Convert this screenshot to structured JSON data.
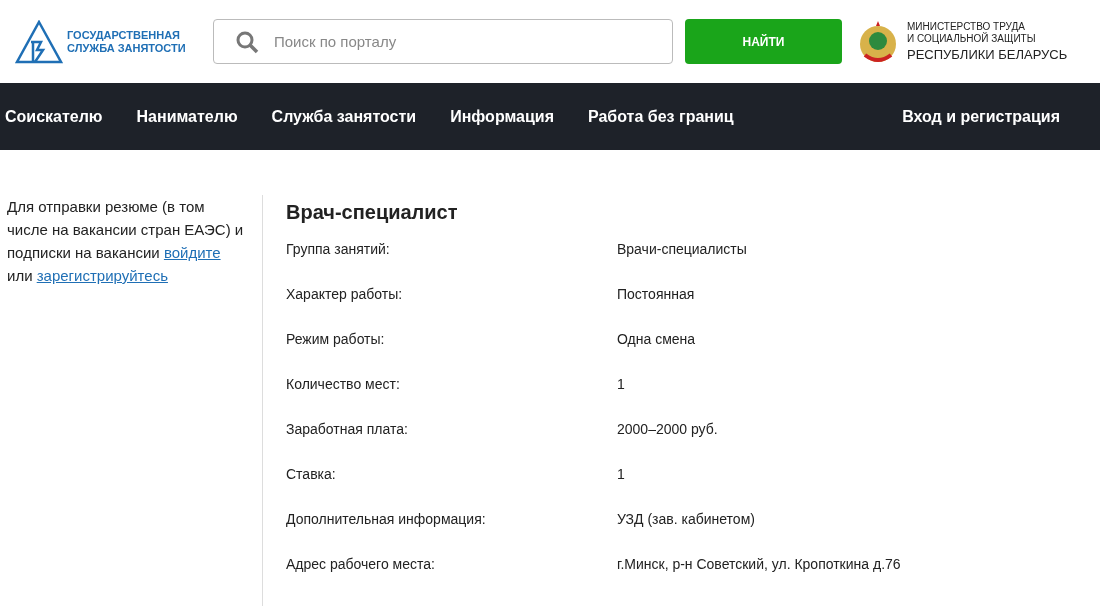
{
  "header": {
    "logo_text": [
      "ГОСУДАРСТВЕННАЯ",
      "СЛУЖБА ЗАНЯТОСТИ"
    ],
    "search": {
      "placeholder": "Поиск по порталу"
    },
    "search_button": "НАЙТИ",
    "ministry": [
      "МИНИСТЕРСТВО ТРУДА",
      "И СОЦИАЛЬНОЙ ЗАЩИТЫ",
      "РЕСПУБЛИКИ БЕЛАРУСЬ"
    ]
  },
  "nav": {
    "items": [
      "Соискателю",
      "Нанимателю",
      "Служба занятости",
      "Информация",
      "Работа без границ"
    ],
    "login": "Вход и регистрация"
  },
  "sidebar": {
    "parts": [
      {
        "kind": "text",
        "text": "Для отправки резюме (в том числе на вакансии стран ЕАЭС) и подписки на вакансии "
      },
      {
        "kind": "link",
        "text": "войдите"
      },
      {
        "kind": "text",
        "text": " или "
      },
      {
        "kind": "link",
        "text": "зарегистрируйтесь"
      }
    ]
  },
  "vacancy": {
    "title": "Врач-специалист",
    "fields": [
      {
        "label": "Группа занятий:",
        "value": "Врачи-специалисты"
      },
      {
        "label": "Характер работы:",
        "value": "Постоянная"
      },
      {
        "label": "Режим работы:",
        "value": "Одна смена"
      },
      {
        "label": "Количество мест:",
        "value": "1"
      },
      {
        "label": "Заработная плата:",
        "value": "2000–2000 руб."
      },
      {
        "label": "Ставка:",
        "value": "1"
      },
      {
        "label": "Дополнительная информация:",
        "value": "УЗД (зав. кабинетом)"
      },
      {
        "label": "Адрес рабочего места:",
        "value": "г.Минск, р-н Советский, ул. Кропоткина д.76"
      }
    ]
  }
}
